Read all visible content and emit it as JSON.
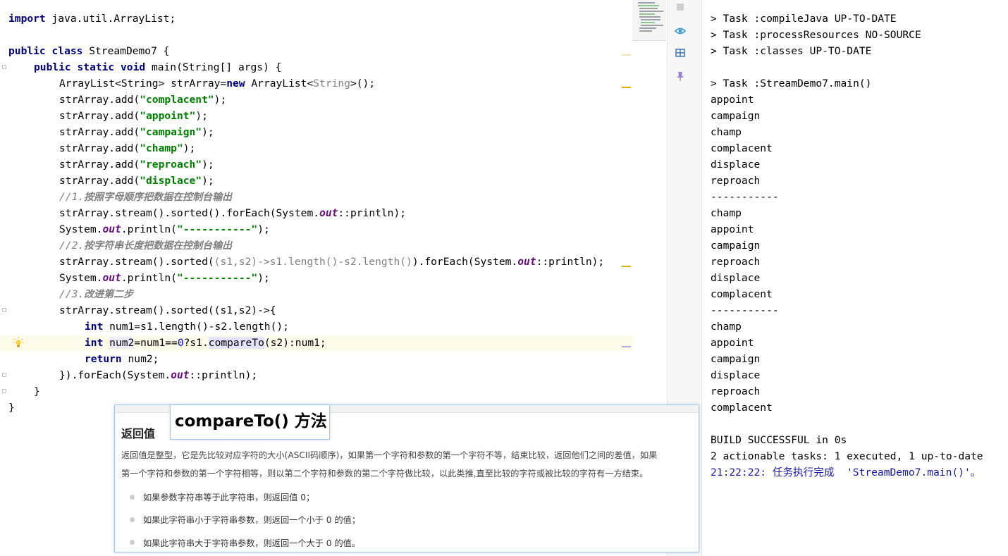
{
  "editor": {
    "code": {
      "l1": [
        "import",
        " java.util.ArrayList;"
      ],
      "l3": [
        "public class",
        " StreamDemo7 {"
      ],
      "l4": [
        "public static void",
        " main(String[] args) {"
      ],
      "l5": [
        "ArrayList<String> strArray=",
        "new",
        " ArrayList<",
        "String",
        ">();"
      ],
      "l6": [
        "strArray.add(",
        "\"complacent\"",
        ");"
      ],
      "l7": [
        "strArray.add(",
        "\"appoint\"",
        ");"
      ],
      "l8": [
        "strArray.add(",
        "\"campaign\"",
        ");"
      ],
      "l9": [
        "strArray.add(",
        "\"champ\"",
        ");"
      ],
      "l10": [
        "strArray.add(",
        "\"reproach\"",
        ");"
      ],
      "l11": [
        "strArray.add(",
        "\"displace\"",
        ");"
      ],
      "l12": [
        "//1.",
        "按照字母顺序把数据在控制台输出"
      ],
      "l13": [
        "strArray.stream().sorted().forEach(System.",
        "out",
        "::println);"
      ],
      "l14": [
        "System.",
        "out",
        ".println(",
        "\"-----------\"",
        ");"
      ],
      "l15": [
        "//2.",
        "按字符串长度把数据在控制台输出"
      ],
      "l16": [
        "strArray.stream().sorted(",
        "(s1,s2)->s1.length()-s2.length()",
        ").forEach(System.",
        "out",
        "::println);"
      ],
      "l17": [
        "System.",
        "out",
        ".println(",
        "\"-----------\"",
        ");"
      ],
      "l18": [
        "//3.",
        "改进第二步"
      ],
      "l19": [
        "strArray.stream().sorted((s1,s2)->{"
      ],
      "l20": [
        "int",
        " num1=s1.length()-s2.length();"
      ],
      "l21": [
        "int",
        " ",
        "num2",
        "=num1==",
        "0",
        "?s1.",
        "compareTo",
        "(s2):num1;"
      ],
      "l22": [
        "return",
        " num2;"
      ],
      "l23": [
        "}).forEach(System.",
        "out",
        "::println);"
      ],
      "l24": [
        "}"
      ],
      "l25": [
        "}"
      ]
    },
    "gutter_icon": "lightbulb-icon",
    "colors": {
      "keyword": "#000080",
      "string": "#008000",
      "comment": "#808080",
      "field": "#660e7a",
      "number": "#0000ff",
      "current_line": "#fcfae8"
    }
  },
  "side_icons": [
    "stop-icon",
    "eye-icon",
    "layout-icon",
    "pin-icon"
  ],
  "console": {
    "lines": [
      "> Task :compileJava UP-TO-DATE",
      "> Task :processResources NO-SOURCE",
      "> Task :classes UP-TO-DATE",
      "",
      "> Task :StreamDemo7.main()",
      "appoint",
      "campaign",
      "champ",
      "complacent",
      "displace",
      "reproach",
      "-----------",
      "champ",
      "appoint",
      "campaign",
      "reproach",
      "displace",
      "complacent",
      "-----------",
      "champ",
      "appoint",
      "campaign",
      "displace",
      "reproach",
      "complacent",
      "",
      "BUILD SUCCESSFUL in 0s",
      "2 actionable tasks: 1 executed, 1 up-to-date"
    ],
    "last": {
      "time": "21:22:22",
      "message": ": 任务执行完成  'StreamDemo7.main()'。"
    }
  },
  "popup": {
    "callout": "compareTo() 方法",
    "heading": "返回值",
    "para1": "返回值是整型，它是先比较对应字符的大小(ASCII码顺序)，如果第一个字符和参数的第一个字符不等，结束比较，返回他们之间的差值，如果",
    "para2": "第一个字符和参数的第一个字符相等，则以第二个字符和参数的第二个字符做比较，以此类推,直至比较的字符或被比较的字符有一方结束。",
    "bullets": [
      "如果参数字符串等于此字符串，则返回值 0；",
      "如果此字符串小于字符串参数，则返回一个小于 0 的值；",
      "如果此字符串大于字符串参数，则返回一个大于 0 的值。"
    ]
  }
}
